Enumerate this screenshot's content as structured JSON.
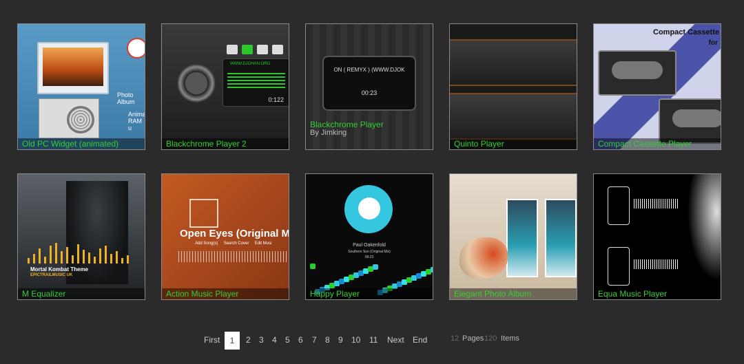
{
  "tiles": [
    {
      "title": "Old PC Widget (animated)",
      "side_texts": [
        "Photo Album",
        "Animat",
        "RAM u"
      ]
    },
    {
      "title": "Blackchrome Player 2",
      "display_text": "WWW.DJOHAN.ORG",
      "time": "0:122"
    },
    {
      "title": "Blackchrome Player",
      "subtitle": "By Jimking",
      "display_text": "ON ( REMYX ) (WWW.DJOK",
      "time": "00:23"
    },
    {
      "title": "Quinto Player"
    },
    {
      "title": "Compact Cassette Player",
      "heading": "Compact Cassette",
      "heading2": "for"
    },
    {
      "title": "M Equalizer",
      "track": "Mortal Kombat Theme",
      "artist": "EPICTRAILMUSIC UK"
    },
    {
      "title": "Action Music Player",
      "track": "Open Eyes (Original Mix) - T",
      "actions": [
        "Add Song(s)",
        "Search Cover",
        "Edit Musi"
      ]
    },
    {
      "title": "Happy Player",
      "track": "Paul Oakenfold",
      "sub": "Southern Sun (Original Mix)",
      "time": "09:23"
    },
    {
      "title": "Elegant Photo Album"
    },
    {
      "title": "Equa Music Player"
    }
  ],
  "pager": {
    "first": "First",
    "pages": [
      "1",
      "2",
      "3",
      "4",
      "5",
      "6",
      "7",
      "8",
      "9",
      "10",
      "11"
    ],
    "active": "1",
    "next": "Next",
    "end": "End",
    "page_count": "12",
    "pages_label": "Pages",
    "item_count": "120",
    "items_label": "Items"
  }
}
